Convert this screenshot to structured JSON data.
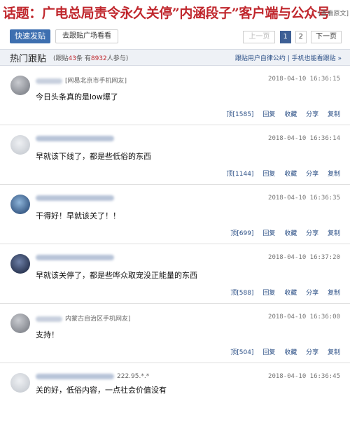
{
  "topic": {
    "title": "话题：广电总局责令永久关停”内涵段子”客户端与公众号",
    "view_link": "[查看原文]"
  },
  "toolbar": {
    "post_button": "快速发贴",
    "plaza_button": "去跟贴广场看看",
    "pager": {
      "prev": "上一页",
      "page1": "1",
      "page2": "2",
      "next": "下一页"
    }
  },
  "section": {
    "title": "热门跟贴",
    "stats_prefix": "(跟贴",
    "post_count": "43",
    "stats_mid": "条 有",
    "participant_count": "8932",
    "stats_suffix": "人参与)",
    "convention_link": "跟贴用户自律公约",
    "separator": "|",
    "mobile_link": "手机也能看跟贴 »"
  },
  "comments": [
    {
      "user": "[网易北京市手机网友]",
      "time": "2018-04-10  16:36:15",
      "text": "今日头条真的是low爆了",
      "actions": {
        "upvote": "顶[1585]",
        "reply": "回复",
        "collect": "收藏",
        "share": "分享",
        "copy": "复制"
      }
    },
    {
      "user": "",
      "time": "2018-04-10  16:36:14",
      "text": "早就该下线了，都是些低俗的东西",
      "actions": {
        "upvote": "顶[1144]",
        "reply": "回复",
        "collect": "收藏",
        "share": "分享",
        "copy": "复制"
      }
    },
    {
      "user": "",
      "time": "2018-04-10  16:36:35",
      "text": "干得好！早就该关了！！",
      "actions": {
        "upvote": "顶[699]",
        "reply": "回复",
        "collect": "收藏",
        "share": "分享",
        "copy": "复制"
      }
    },
    {
      "user": "",
      "time": "2018-04-10  16:37:20",
      "text": "早就该关停了，都是些哗众取宠没正能量的东西",
      "actions": {
        "upvote": "顶[588]",
        "reply": "回复",
        "collect": "收藏",
        "share": "分享",
        "copy": "复制"
      }
    },
    {
      "user": "内蒙古自治区手机网友]",
      "time": "2018-04-10  16:36:00",
      "text": "支持！",
      "actions": {
        "upvote": "顶[504]",
        "reply": "回复",
        "collect": "收藏",
        "share": "分享",
        "copy": "复制"
      }
    },
    {
      "user": "222.95.*.*",
      "time": "2018-04-10  16:36:45",
      "text": "关的好，低俗内容，一点社会价值没有",
      "actions": {
        "upvote": "",
        "reply": "",
        "collect": "",
        "share": "",
        "copy": ""
      }
    }
  ],
  "colors": {
    "title_red": "#c0272d",
    "button_blue": "#3d6fb0",
    "link_blue": "#2b4f86",
    "pager_current": "#3d5f95"
  }
}
